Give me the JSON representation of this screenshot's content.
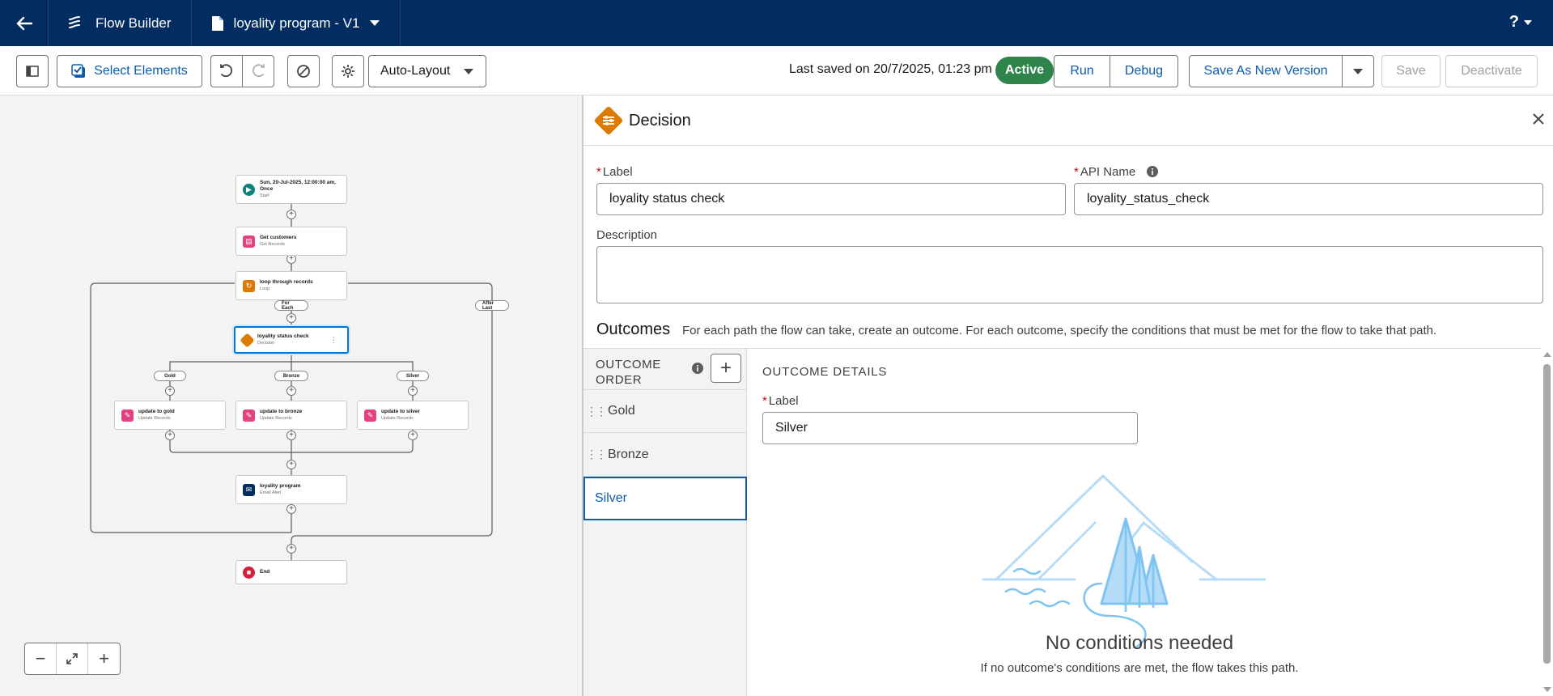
{
  "topbar": {
    "app_name": "Flow Builder",
    "file_name": "loyality program - V1",
    "help_label": "?"
  },
  "toolbar": {
    "select_elements_label": "Select Elements",
    "layout_mode": "Auto-Layout",
    "last_saved": "Last saved on 20/7/2025, 01:23 pm",
    "status_badge": "Active",
    "run_label": "Run",
    "debug_label": "Debug",
    "save_new_version_label": "Save As New Version",
    "save_label": "Save",
    "deactivate_label": "Deactivate"
  },
  "canvas": {
    "nodes": {
      "start": {
        "title": "Sun, 20-Jul-2025, 12:00:00 am,",
        "title2": "Once",
        "sub": "Start"
      },
      "get": {
        "title": "Get customers",
        "sub": "Get Records"
      },
      "loop": {
        "title": "loop through records",
        "sub": "Loop"
      },
      "decision": {
        "title": "loyality status check",
        "sub": "Decision"
      },
      "upd_gold": {
        "title": "update to gold",
        "sub": "Update Records"
      },
      "upd_bronze": {
        "title": "update to bronze",
        "sub": "Update Records"
      },
      "upd_silver": {
        "title": "update to silver",
        "sub": "Update Records"
      },
      "email": {
        "title": "loyality program",
        "sub": "Email Alert"
      },
      "end": {
        "title": "End"
      }
    },
    "labels": {
      "for_each": "For Each",
      "after_last": "After Last",
      "gold": "Gold",
      "bronze": "Bronze",
      "silver": "Silver"
    }
  },
  "panel": {
    "title": "Decision",
    "label_field_label": "Label",
    "label_value": "loyality status check",
    "api_name_label": "API Name",
    "api_name_value": "loyality_status_check",
    "description_label": "Description",
    "description_value": "",
    "outcomes_title": "Outcomes",
    "outcomes_desc": "For each path the flow can take, create an outcome. For each outcome, specify the conditions that must be met for the flow to take that path.",
    "outcome_order_line1": "OUTCOME",
    "outcome_order_line2": "ORDER",
    "outcomes": [
      "Gold",
      "Bronze",
      "Silver"
    ],
    "selected_outcome": "Silver",
    "details_head": "OUTCOME DETAILS",
    "details_label": "Label",
    "details_label_value": "Silver",
    "no_conditions_title": "No conditions needed",
    "no_conditions_text": "If no outcome's conditions are met, the flow takes this path."
  },
  "colors": {
    "topbar": "#032d60",
    "brand_blue": "#0b5cab",
    "active_green": "#2e844a",
    "decision_orange": "#dd7a01",
    "records_pink": "#e3417f",
    "start_teal": "#0b827c",
    "end_red": "#d4203b"
  }
}
